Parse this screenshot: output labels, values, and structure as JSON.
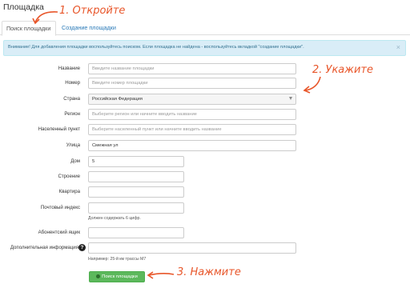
{
  "page": {
    "title": "Площадка"
  },
  "tabs": [
    {
      "label": "Поиск площадки",
      "active": true
    },
    {
      "label": "Создание площадки",
      "active": false
    }
  ],
  "alert": {
    "text": "Внимание! Для добавления площадки воспользуйтесь поиском. Если площадка не найдена - воспользуйтесь вкладкой \"создание площадки\".",
    "close": "×"
  },
  "form": {
    "name": {
      "label": "Название",
      "placeholder": "Введите название площадки"
    },
    "number": {
      "label": "Номер",
      "placeholder": "Введите номер площадки"
    },
    "country": {
      "label": "Страна",
      "value": "Российская Федерация"
    },
    "region": {
      "label": "Регион",
      "placeholder": "Выберите регион или начните вводить название"
    },
    "settlement": {
      "label": "Населенный пункт",
      "placeholder": "Выберите населенный пункт или начните вводить название"
    },
    "street": {
      "label": "Улица",
      "value": "Смежная ул"
    },
    "house": {
      "label": "Дом",
      "value": "5"
    },
    "building": {
      "label": "Строение",
      "value": ""
    },
    "apartment": {
      "label": "Квартира",
      "value": ""
    },
    "postal": {
      "label": "Почтовый индекс",
      "value": "",
      "hint": "Должен содержать 6 цифр."
    },
    "pobox": {
      "label": "Абонентский ящик",
      "value": ""
    },
    "extra": {
      "label": "Дополнительная информация",
      "value": "",
      "hint": "Например: 25-й км трассы М7",
      "help_icon": "?"
    }
  },
  "search_button": {
    "label": "Поиск площадки",
    "icon": "search-icon"
  },
  "annotations": {
    "step1": "1. Откройте",
    "step2": "2. Укажите",
    "step3": "3. Нажмите",
    "color": "#e8562a"
  },
  "colors": {
    "accent_link": "#2a7ab8",
    "alert_bg": "#d9edf7",
    "alert_text": "#31708f",
    "button_green": "#5cb85c"
  }
}
